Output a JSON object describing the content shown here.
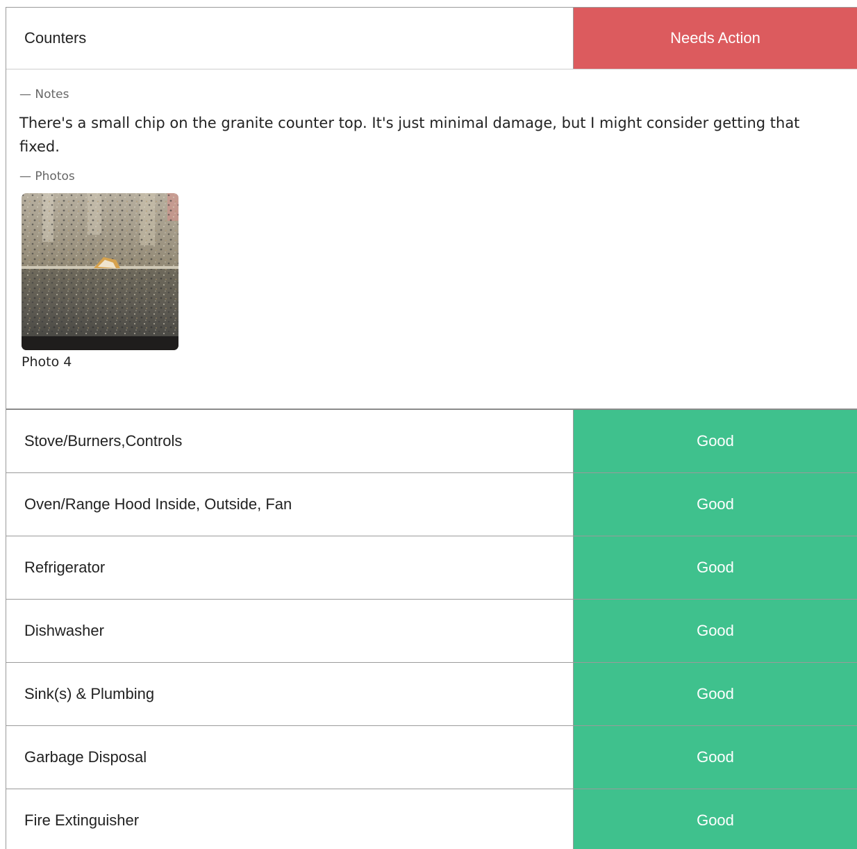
{
  "header": {
    "title": "Counters",
    "status": "Needs Action",
    "status_color": "#dc5b5e"
  },
  "detail": {
    "notes_title": "— Notes",
    "notes_text": "There's a small chip on the granite counter top. It's just minimal damage, but I might consider getting that fixed.",
    "photos_title": "— Photos",
    "photos": [
      {
        "caption": "Photo 4"
      }
    ]
  },
  "items": [
    {
      "label": "Stove/Burners,Controls",
      "status": "Good"
    },
    {
      "label": "Oven/Range Hood Inside, Outside, Fan",
      "status": "Good"
    },
    {
      "label": "Refrigerator",
      "status": "Good"
    },
    {
      "label": "Dishwasher",
      "status": "Good"
    },
    {
      "label": "Sink(s) & Plumbing",
      "status": "Good"
    },
    {
      "label": "Garbage Disposal",
      "status": "Good"
    },
    {
      "label": "Fire Extinguisher",
      "status": "Good"
    }
  ],
  "colors": {
    "good": "#3fc18d",
    "needs_action": "#dc5b5e"
  }
}
